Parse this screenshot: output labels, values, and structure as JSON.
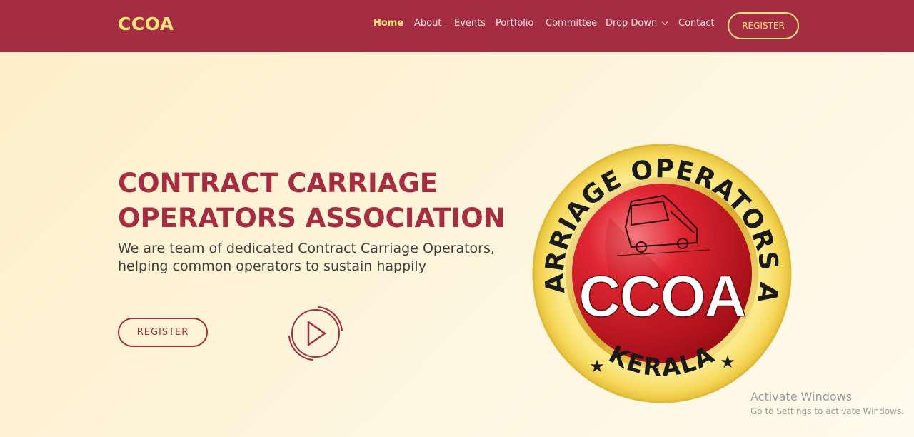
{
  "header": {
    "brand": "CCOA",
    "nav": [
      {
        "label": "Home",
        "active": true
      },
      {
        "label": "About"
      },
      {
        "label": "Events"
      },
      {
        "label": "Portfolio"
      },
      {
        "label": "Committee"
      },
      {
        "label": "Drop Down",
        "has_dropdown": true,
        "icon": "chevron-down-icon"
      },
      {
        "label": "Contact"
      }
    ],
    "register_label": "REGISTER"
  },
  "hero": {
    "title_line1": "CONTRACT CARRIAGE",
    "title_line2": "OPERATORS ASSOCIATION",
    "subtitle_line1": "We are team of dedicated Contract Carriage Operators,",
    "subtitle_line2": "helping common operators to sustain happily",
    "register_label": "REGISTER",
    "play_icon": "play-icon"
  },
  "logo": {
    "ring_text": "CONTRACT CARRIAGE OPERATORS ASSOCIATION",
    "center_text": "CCOA",
    "bottom_text": "KERALA",
    "icon": "bus-icon"
  },
  "watermark": {
    "line1": "Activate Windows",
    "line2": "Go to Settings to activate Windows."
  },
  "colors": {
    "primary": "#a52d41",
    "accent": "#fbe47a",
    "background": "#fdf1d2"
  }
}
